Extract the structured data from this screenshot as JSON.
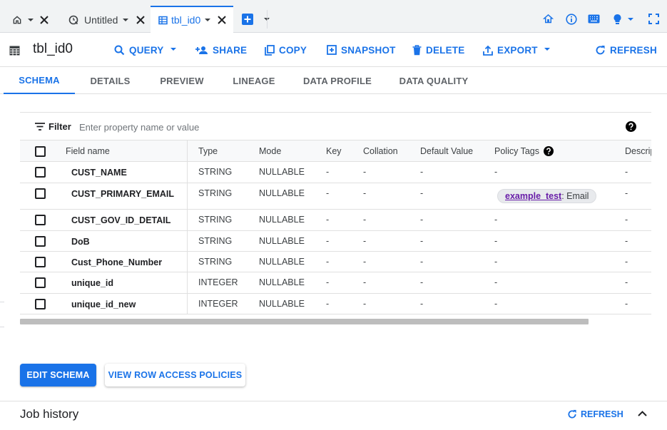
{
  "tabs": {
    "home_tab": {
      "icon": "home-icon"
    },
    "items": [
      {
        "label": "Untitled",
        "icon": "query-icon"
      },
      {
        "label": "tbl_id0",
        "icon": "table-icon"
      }
    ]
  },
  "toolbar": {
    "title": "tbl_id0",
    "buttons": {
      "query": "QUERY",
      "share": "SHARE",
      "copy": "COPY",
      "snapshot": "SNAPSHOT",
      "delete": "DELETE",
      "export": "EXPORT",
      "refresh": "REFRESH"
    }
  },
  "subtabs": [
    "SCHEMA",
    "DETAILS",
    "PREVIEW",
    "LINEAGE",
    "DATA PROFILE",
    "DATA QUALITY"
  ],
  "filter": {
    "label": "Filter",
    "placeholder": "Enter property name or value"
  },
  "table": {
    "headers": {
      "field_name": "Field name",
      "type": "Type",
      "mode": "Mode",
      "key": "Key",
      "collation": "Collation",
      "default_value": "Default Value",
      "policy_tags": "Policy Tags",
      "description": "Description"
    },
    "rows": [
      {
        "name": "CUST_NAME",
        "type": "STRING",
        "mode": "NULLABLE",
        "key": "-",
        "collation": "-",
        "default": "-",
        "policy": "-",
        "desc": "-"
      },
      {
        "name": "CUST_PRIMARY_EMAIL",
        "type": "STRING",
        "mode": "NULLABLE",
        "key": "-",
        "collation": "-",
        "default": "-",
        "policy_tag": "example_test",
        "policy_suffix": " : Email",
        "desc": "-"
      },
      {
        "name": "CUST_GOV_ID_DETAIL",
        "type": "STRING",
        "mode": "NULLABLE",
        "key": "-",
        "collation": "-",
        "default": "-",
        "policy": "-",
        "desc": "-"
      },
      {
        "name": "DoB",
        "type": "STRING",
        "mode": "NULLABLE",
        "key": "-",
        "collation": "-",
        "default": "-",
        "policy": "-",
        "desc": "-"
      },
      {
        "name": "Cust_Phone_Number",
        "type": "STRING",
        "mode": "NULLABLE",
        "key": "-",
        "collation": "-",
        "default": "-",
        "policy": "-",
        "desc": "-"
      },
      {
        "name": "unique_id",
        "type": "INTEGER",
        "mode": "NULLABLE",
        "key": "-",
        "collation": "-",
        "default": "-",
        "policy": "-",
        "desc": "-"
      },
      {
        "name": "unique_id_new",
        "type": "INTEGER",
        "mode": "NULLABLE",
        "key": "-",
        "collation": "-",
        "default": "-",
        "policy": "-",
        "desc": "-"
      }
    ]
  },
  "actions": {
    "edit_schema": "EDIT SCHEMA",
    "view_row_access": "VIEW ROW ACCESS POLICIES"
  },
  "job_history": {
    "title": "Job history",
    "refresh": "REFRESH"
  },
  "colors": {
    "accent": "#1a73e8",
    "policy_tag": "#681da8"
  }
}
